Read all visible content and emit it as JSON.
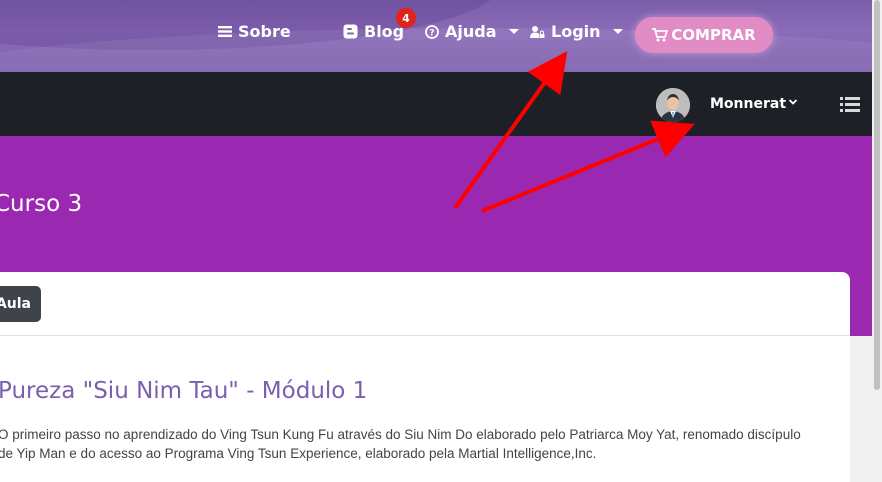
{
  "topnav": {
    "sobre_label": "Sobre",
    "blog_label": "Blog",
    "blog_badge": "4",
    "ajuda_label": "Ajuda",
    "login_label": "Login",
    "buy_label": "COMPRAR"
  },
  "userbar": {
    "username": "Monnerat"
  },
  "banner": {
    "title": "Curso 3"
  },
  "card": {
    "aula_button": "Aula",
    "lesson_title": "Pureza \"Siu Nim Tau\" - Módulo 1",
    "description_line1": "O primeiro passo no aprendizado do Ving Tsun Kung Fu através do Siu Nim Do elaborado pelo Patriarca Moy Yat, renomado discípulo",
    "description_line2": "de Yip Man e do acesso ao Programa Ving Tsun Experience, elaborado pela Martial Intelligence,Inc."
  },
  "colors": {
    "top_nav": "#8a6bb8",
    "dark_bar": "#1d2026",
    "banner": "#9a28b0",
    "buy_button": "#e28cc6",
    "badge": "#e2231a",
    "annotation_arrow": "#ff0000"
  },
  "icons": [
    "menu-lines-icon",
    "blogger-icon",
    "question-circle-icon",
    "user-lock-icon",
    "cart-icon",
    "chevron-down-icon",
    "list-icon"
  ]
}
